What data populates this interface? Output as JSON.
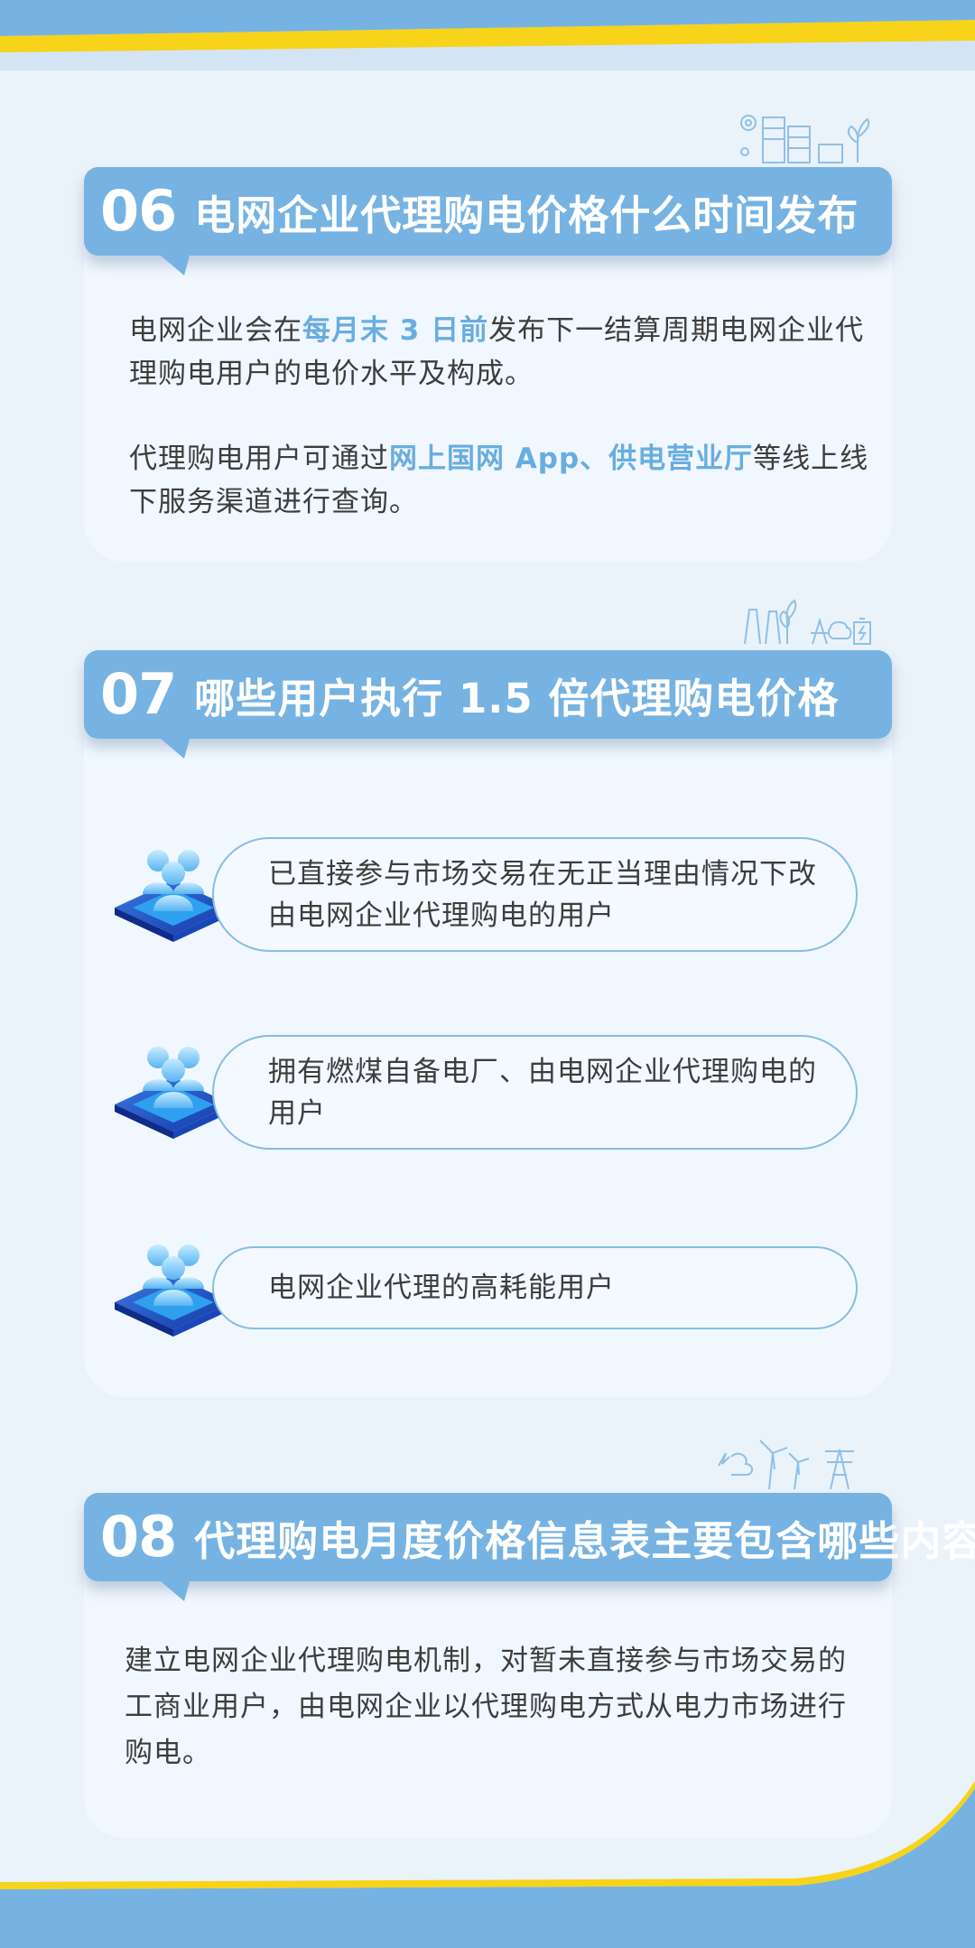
{
  "sections": [
    {
      "number": "06",
      "title": "电网企业代理购电价格什么时间发布",
      "p1": {
        "pre": "电网企业会在",
        "highlight": "每月末 3 日前",
        "post": "发布下一结算周期电网企业代理购电用户的电价水平及构成。"
      },
      "p2": {
        "pre": "代理购电用户可通过",
        "highlight": "网上国网 App、供电营业厅",
        "post": "等线上线下服务渠道进行查询。"
      }
    },
    {
      "number": "07",
      "title": "哪些用户执行 1.5 倍代理购电价格",
      "items": [
        "已直接参与市场交易在无正当理由情况下改由电网企业代理购电的用户",
        "拥有燃煤自备电厂、由电网企业代理购电的用户",
        "电网企业代理的高耗能用户"
      ]
    },
    {
      "number": "08",
      "title": "代理购电月度价格信息表主要包含哪些内容?",
      "body": "建立电网企业代理购电机制，对暂未直接参与市场交易的工商业用户，由电网企业以代理购电方式从电力市场进行购电。"
    }
  ],
  "colors": {
    "accent": "#76b3e2",
    "highlight": "#68ade0",
    "yellow": "#f7d31a",
    "card": "#f0f7fe",
    "background": "#eaf2fa"
  },
  "icons": [
    "city-solar-icon",
    "power-plant-icon",
    "wind-energy-icon",
    "user-group-icon"
  ]
}
